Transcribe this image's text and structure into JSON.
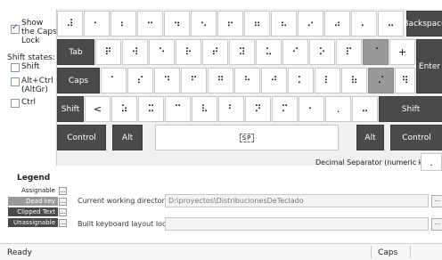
{
  "options": {
    "show_caps_lock": "Show the Caps Lock",
    "shift_states_title": "Shift states:",
    "shift": "Shift",
    "alt_ctrl": "Alt+Ctrl (AltGr)",
    "ctrl": "Ctrl"
  },
  "keyboard": {
    "row1": [
      "⠼",
      "⠂",
      "⠆",
      "⠒",
      "⠲",
      "⠢",
      "⠖",
      "⠶",
      "⠦",
      "⠔",
      "⠴",
      "⠄",
      "⠤"
    ],
    "backspace": "Backspace",
    "tab": "Tab",
    "row2": [
      "⠟",
      "⠺",
      "⠑",
      "⠗",
      "⠞",
      "⠽",
      "⠥",
      "⠊",
      "⠕",
      "⠏",
      "⠈",
      "+"
    ],
    "enter": "Enter",
    "caps": "Caps",
    "row3": [
      "⠁",
      "⠎",
      "⠙",
      "⠋",
      "⠛",
      "⠓",
      "⠚",
      "⠅",
      "⠇",
      "⠷",
      "⠌",
      "⠻"
    ],
    "shift_left": "Shift",
    "row4": [
      "<",
      "⠵",
      "⠭",
      "⠉",
      "⠧",
      "⠃",
      "⠝",
      "⠍",
      "⠂",
      ".",
      "⠤"
    ],
    "shift_right": "Shift",
    "control_left": "Control",
    "alt_left": "Alt",
    "space": "SP",
    "alt_right": "Alt",
    "control_right": "Control"
  },
  "decimal_separator": {
    "label": "Decimal Separator (numeric keypad)",
    "value": "."
  },
  "legend": {
    "title": "Legend",
    "items": [
      "Assignable",
      "Dead key",
      "Clipped Text",
      "Unassignable"
    ],
    "button": "..."
  },
  "cwd": {
    "label": "Current working directory",
    "value": "D:\\proyectos\\DistribucionesDeTeclado",
    "button": "..."
  },
  "layout_location": {
    "label": "Built keyboard layout location",
    "value": "",
    "button": "..."
  },
  "status": {
    "left": "Ready",
    "caps": "Caps"
  }
}
